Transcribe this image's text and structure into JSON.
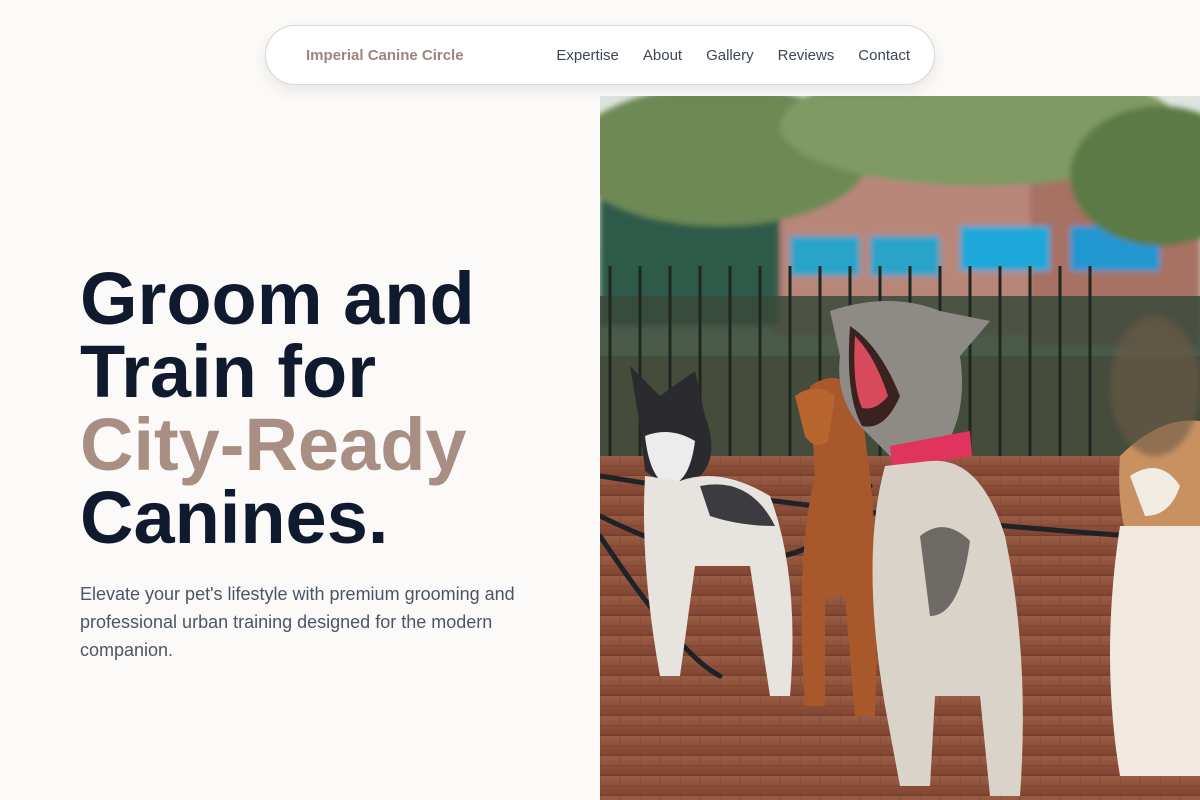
{
  "nav": {
    "brand": "Imperial Canine Circle",
    "links": [
      "Expertise",
      "About",
      "Gallery",
      "Reviews",
      "Contact"
    ]
  },
  "hero": {
    "headline_line1": "Groom and",
    "headline_line2": "Train for",
    "headline_accent": "City-Ready",
    "headline_line4": "Canines.",
    "subtitle": "Elevate your pet's lifestyle with premium grooming and professional urban training designed for the modern companion."
  },
  "colors": {
    "background": "#fcfaf8",
    "brand": "#9e857b",
    "accent": "#a88e83",
    "heading": "#101a2e",
    "body_text": "#4b5566"
  }
}
